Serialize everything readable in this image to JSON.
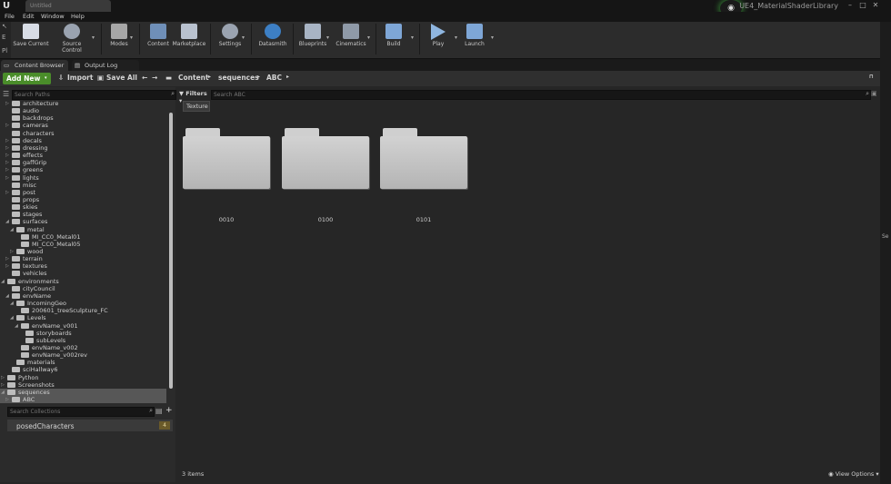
{
  "window": {
    "tab_title": "Untitled",
    "project_name": "UE4_MaterialShaderLibrary",
    "controls": [
      "–",
      "□",
      "✕"
    ]
  },
  "menu": [
    "File",
    "Edit",
    "Window",
    "Help"
  ],
  "toolbar": {
    "buttons": [
      {
        "label": "Save Current",
        "icon": "save-icon"
      },
      {
        "label": "Source Control",
        "icon": "source-control-icon"
      },
      {
        "label": "Modes",
        "icon": "modes-icon"
      },
      {
        "label": "Content",
        "icon": "content-icon"
      },
      {
        "label": "Marketplace",
        "icon": "marketplace-icon"
      },
      {
        "label": "Settings",
        "icon": "settings-icon"
      },
      {
        "label": "Datasmith",
        "icon": "datasmith-icon"
      },
      {
        "label": "Blueprints",
        "icon": "blueprints-icon"
      },
      {
        "label": "Cinematics",
        "icon": "cinematics-icon"
      },
      {
        "label": "Build",
        "icon": "build-icon"
      },
      {
        "label": "Play",
        "icon": "play-icon"
      },
      {
        "label": "Launch",
        "icon": "launch-icon"
      }
    ]
  },
  "tabs": {
    "content_browser": "Content Browser",
    "output_log": "Output Log"
  },
  "content_toolbar": {
    "add_new": "Add New",
    "import": "Import",
    "save_all": "Save All",
    "breadcrumb": [
      "Content",
      "sequences",
      "ABC"
    ]
  },
  "sources": {
    "search_placeholder": "Search Paths",
    "tree": [
      {
        "label": "architecture",
        "depth": 1,
        "arrow": "▷"
      },
      {
        "label": "audio",
        "depth": 1,
        "arrow": ""
      },
      {
        "label": "backdrops",
        "depth": 1,
        "arrow": ""
      },
      {
        "label": "cameras",
        "depth": 1,
        "arrow": "▷"
      },
      {
        "label": "characters",
        "depth": 1,
        "arrow": ""
      },
      {
        "label": "decals",
        "depth": 1,
        "arrow": "▷"
      },
      {
        "label": "dressing",
        "depth": 1,
        "arrow": "▷"
      },
      {
        "label": "effects",
        "depth": 1,
        "arrow": "▷"
      },
      {
        "label": "gaffGrip",
        "depth": 1,
        "arrow": "▷"
      },
      {
        "label": "greens",
        "depth": 1,
        "arrow": "▷"
      },
      {
        "label": "lights",
        "depth": 1,
        "arrow": "▷"
      },
      {
        "label": "misc",
        "depth": 1,
        "arrow": ""
      },
      {
        "label": "post",
        "depth": 1,
        "arrow": "▷"
      },
      {
        "label": "props",
        "depth": 1,
        "arrow": ""
      },
      {
        "label": "skies",
        "depth": 1,
        "arrow": ""
      },
      {
        "label": "stages",
        "depth": 1,
        "arrow": ""
      },
      {
        "label": "surfaces",
        "depth": 1,
        "arrow": "◢"
      },
      {
        "label": "metal",
        "depth": 2,
        "arrow": "◢"
      },
      {
        "label": "MI_CC0_Metal01",
        "depth": 3,
        "arrow": ""
      },
      {
        "label": "MI_CC0_Metal05",
        "depth": 3,
        "arrow": ""
      },
      {
        "label": "wood",
        "depth": 2,
        "arrow": "▷"
      },
      {
        "label": "terrain",
        "depth": 1,
        "arrow": "▷"
      },
      {
        "label": "textures",
        "depth": 1,
        "arrow": "▷"
      },
      {
        "label": "vehicles",
        "depth": 1,
        "arrow": ""
      },
      {
        "label": "environments",
        "depth": 0,
        "arrow": "◢"
      },
      {
        "label": "cityCouncil",
        "depth": 1,
        "arrow": ""
      },
      {
        "label": "envName",
        "depth": 1,
        "arrow": "◢"
      },
      {
        "label": "IncomingGeo",
        "depth": 2,
        "arrow": "◢"
      },
      {
        "label": "200601_treeSculpture_FC",
        "depth": 3,
        "arrow": ""
      },
      {
        "label": "Levels",
        "depth": 2,
        "arrow": "◢"
      },
      {
        "label": "envName_v001",
        "depth": 3,
        "arrow": "◢"
      },
      {
        "label": "storyboards",
        "depth": 4,
        "arrow": ""
      },
      {
        "label": "subLevels",
        "depth": 4,
        "arrow": ""
      },
      {
        "label": "envName_v002",
        "depth": 3,
        "arrow": ""
      },
      {
        "label": "envName_v002rev",
        "depth": 3,
        "arrow": ""
      },
      {
        "label": "materials",
        "depth": 2,
        "arrow": ""
      },
      {
        "label": "sciHallway6",
        "depth": 1,
        "arrow": ""
      },
      {
        "label": "Python",
        "depth": 0,
        "arrow": "▷"
      },
      {
        "label": "Screenshots",
        "depth": 0,
        "arrow": "▷"
      },
      {
        "label": "sequences",
        "depth": 0,
        "arrow": "◢",
        "selected": true
      },
      {
        "label": "ABC",
        "depth": 1,
        "arrow": "▷",
        "selected": true
      }
    ],
    "collections_placeholder": "Search Collections",
    "collection": {
      "name": "posedCharacters",
      "count": "4"
    }
  },
  "assets": {
    "filters_label": "Filters",
    "search_placeholder": "Search ABC",
    "active_filter": "Texture",
    "folders": [
      "0010",
      "0100",
      "0101"
    ],
    "item_count": "3 items",
    "view_options": "View Options"
  },
  "right_strip": {
    "label": "Se"
  },
  "colors": {
    "accent_green": "#4a8d2a",
    "panel_bg": "#2b2b2b",
    "asset_bg": "#262626",
    "selection": "#575757"
  }
}
